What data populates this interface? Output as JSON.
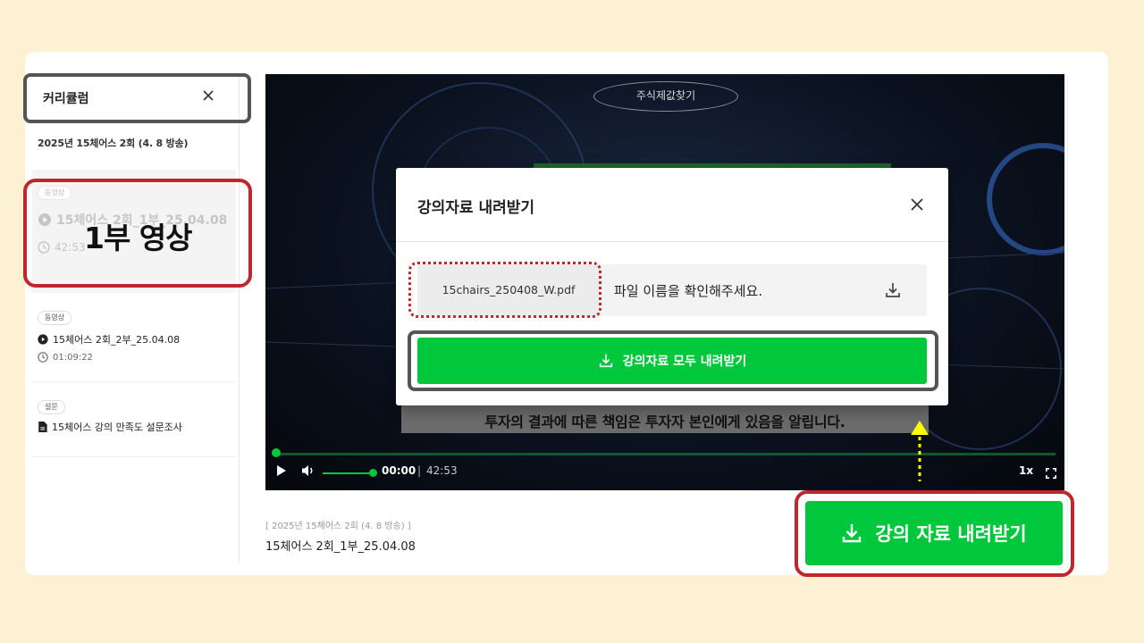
{
  "sidebar": {
    "title": "커리큘럼",
    "course": "2025년 15체어스 2회 (4. 8 방송)",
    "items": [
      {
        "tag": "동영상",
        "title": "15체어스 2회_1부_25.04.08",
        "duration": "42:53"
      },
      {
        "tag": "동영상",
        "title": "15체어스 2회_2부_25.04.08",
        "duration": "01:09:22"
      },
      {
        "tag": "설문",
        "title": "15체어스 강의 만족도 설문조사"
      }
    ]
  },
  "video": {
    "overlay_pill": "주식제값찾기",
    "subtitle": "투자의 결과에 따른 책임은 투자자 본인에게 있음을 알립니다.",
    "current_time": "00:00",
    "separator": "|",
    "total_time": "42:53",
    "speed": "1x",
    "progress": 0
  },
  "lecture": {
    "breadcrumb": "[ 2025년 15체어스 2회 (4. 8 방송) ]",
    "title": "15체어스 2회_1부_25.04.08",
    "download_button": "강의 자료 내려받기"
  },
  "modal": {
    "title": "강의자료 내려받기",
    "file_name": "15chairs_250408_W.pdf",
    "file_hint": "파일 이름을 확인해주세요.",
    "download_all": "강의자료 모두 내려받기"
  },
  "annotations": {
    "part1_label": "1부 영상"
  },
  "colors": {
    "page_bg": "#fdf1d4",
    "brand_green": "#00c73c",
    "annotation_red": "#c0272d",
    "annotation_grey": "#555555",
    "arrow_yellow": "#ffff00"
  },
  "icons": [
    "close-icon",
    "play-circle-icon",
    "clock-icon",
    "document-icon",
    "play-icon",
    "volume-icon",
    "fullscreen-icon",
    "download-icon"
  ]
}
